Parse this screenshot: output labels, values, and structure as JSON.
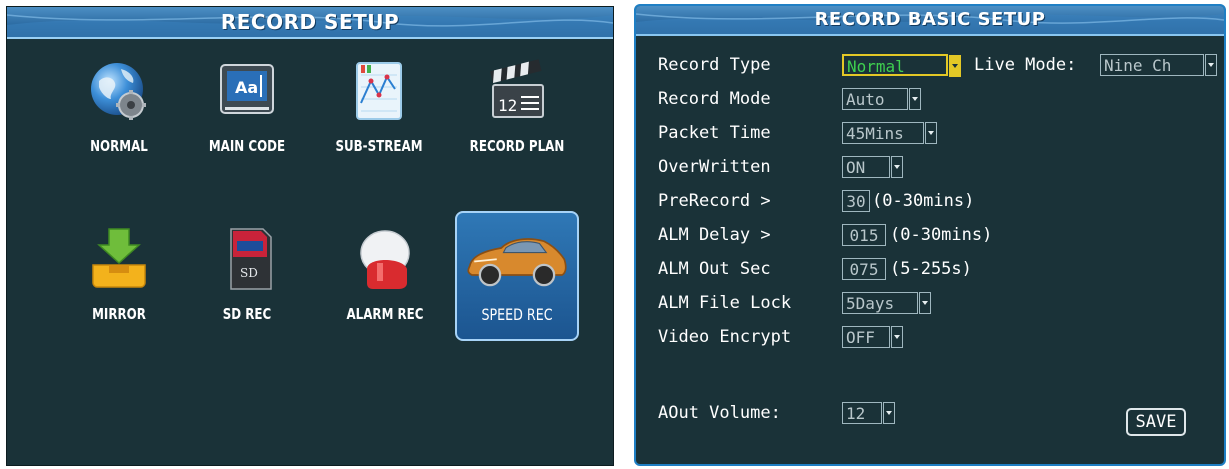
{
  "left": {
    "title": "RECORD  SETUP",
    "tiles": [
      {
        "label": "NORMAL"
      },
      {
        "label": "MAIN CODE"
      },
      {
        "label": "SUB-STREAM"
      },
      {
        "label": "RECORD PLAN"
      },
      {
        "label": "MIRROR"
      },
      {
        "label": "SD REC"
      },
      {
        "label": "ALARM REC"
      },
      {
        "label": "SPEED REC",
        "selected": true
      }
    ]
  },
  "right": {
    "title": "RECORD BASIC SETUP",
    "record_type": {
      "label": "Record Type",
      "value": "Normal"
    },
    "live_mode": {
      "label": "Live Mode:",
      "value": "Nine Ch"
    },
    "record_mode": {
      "label": "Record Mode",
      "value": "Auto"
    },
    "packet_time": {
      "label": "Packet Time",
      "value": "45Mins"
    },
    "overwritten": {
      "label": "OverWritten",
      "value": "ON"
    },
    "prerecord": {
      "label": "PreRecord >",
      "value": "30",
      "hint": "(0-30mins)"
    },
    "alm_delay": {
      "label": "ALM Delay >",
      "value": "015",
      "hint": "(0-30mins)"
    },
    "alm_out_sec": {
      "label": "ALM Out Sec",
      "value": "075",
      "hint": "(5-255s)"
    },
    "alm_file_lock": {
      "label": "ALM File Lock",
      "value": "5Days"
    },
    "video_encrypt": {
      "label": "Video Encrypt",
      "value": "OFF"
    },
    "aout_volume": {
      "label": "AOut Volume:",
      "value": "12"
    },
    "save_label": "SAVE"
  },
  "colors": {
    "panel_bg": "#1a3238",
    "title_blue": "#2e6ea5",
    "focus_yellow": "#e3c826",
    "focus_text_green": "#3fd04f"
  }
}
